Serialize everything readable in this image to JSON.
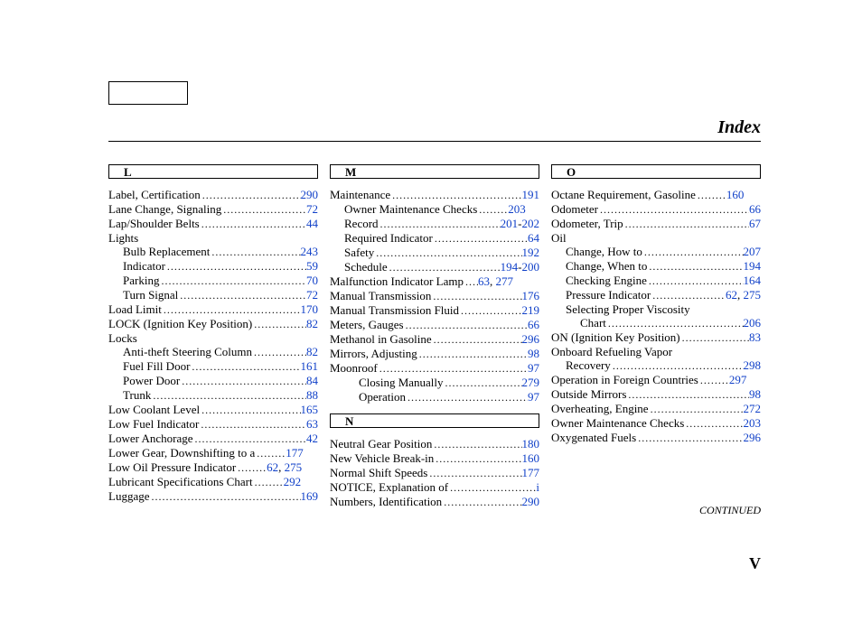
{
  "title": "Index",
  "continued": "CONTINUED",
  "pageNumber": "V",
  "columns": [
    {
      "sections": [
        {
          "letter": "L",
          "entries": [
            {
              "text": "Label, Certification",
              "page": "290",
              "indent": 0
            },
            {
              "text": "Lane Change, Signaling",
              "page": "72",
              "indent": 0
            },
            {
              "text": "Lap/Shoulder Belts",
              "page": "44",
              "indent": 0
            },
            {
              "text": "Lights",
              "page": "",
              "indent": 0,
              "nopage": true
            },
            {
              "text": "Bulb Replacement",
              "page": "243",
              "indent": 1
            },
            {
              "text": "Indicator",
              "page": "59",
              "indent": 1
            },
            {
              "text": "Parking",
              "page": "70",
              "indent": 1
            },
            {
              "text": "Turn Signal",
              "page": "72",
              "indent": 1
            },
            {
              "text": "Load Limit",
              "page": "170",
              "indent": 0
            },
            {
              "text": "LOCK (Ignition Key Position)",
              "page": "82",
              "indent": 0
            },
            {
              "text": "Locks",
              "page": "",
              "indent": 0,
              "nopage": true
            },
            {
              "text": "Anti-theft Steering Column",
              "page": "82",
              "indent": 1
            },
            {
              "text": "Fuel Fill Door",
              "page": "161",
              "indent": 1
            },
            {
              "text": "Power Door",
              "page": "84",
              "indent": 1
            },
            {
              "text": "Trunk",
              "page": "88",
              "indent": 1
            },
            {
              "text": "Low Coolant Level",
              "page": "165",
              "indent": 0
            },
            {
              "text": "Low Fuel Indicator",
              "page": "63",
              "indent": 0
            },
            {
              "text": "Lower Anchorage",
              "page": "42",
              "indent": 0
            },
            {
              "text": "Lower Gear, Downshifting to a",
              "page": "177",
              "indent": 0,
              "tightLeader": true
            },
            {
              "text": "Low Oil Pressure Indicator",
              "page": "62, 275",
              "indent": 0,
              "tightLeader": true,
              "multi": [
                "62",
                "275"
              ]
            },
            {
              "text": "Lubricant Specifications Chart",
              "page": "292",
              "indent": 0,
              "tightLeader": true
            },
            {
              "text": "Luggage",
              "page": "169",
              "indent": 0
            }
          ]
        }
      ]
    },
    {
      "sections": [
        {
          "letter": "M",
          "entries": [
            {
              "text": "Maintenance",
              "page": "191",
              "indent": 0
            },
            {
              "text": "Owner Maintenance Checks",
              "page": "203",
              "indent": 1,
              "tightLeader": true
            },
            {
              "text": "Record",
              "page": "201-202",
              "indent": 1,
              "range": [
                "201",
                "202"
              ]
            },
            {
              "text": "Required Indicator",
              "page": "64",
              "indent": 1
            },
            {
              "text": "Safety",
              "page": "192",
              "indent": 1
            },
            {
              "text": "Schedule",
              "page": "194-200",
              "indent": 1,
              "range": [
                "194",
                "200"
              ]
            },
            {
              "text": "Malfunction Indicator Lamp",
              "page": "63, 277",
              "indent": 0,
              "tightDots": true,
              "multi": [
                "63",
                "277"
              ]
            },
            {
              "text": "Manual Transmission",
              "page": "176",
              "indent": 0
            },
            {
              "text": "Manual Transmission Fluid",
              "page": "219",
              "indent": 0
            },
            {
              "text": "Meters, Gauges",
              "page": "66",
              "indent": 0
            },
            {
              "text": "Methanol in Gasoline",
              "page": "296",
              "indent": 0
            },
            {
              "text": "Mirrors, Adjusting",
              "page": "98",
              "indent": 0
            },
            {
              "text": "Moonroof",
              "page": "97",
              "indent": 0
            },
            {
              "text": "Closing Manually",
              "page": "279",
              "indent": 2
            },
            {
              "text": "Operation",
              "page": "97",
              "indent": 2
            }
          ]
        },
        {
          "letter": "N",
          "entries": [
            {
              "text": "Neutral Gear Position",
              "page": "180",
              "indent": 0
            },
            {
              "text": "New Vehicle Break-in",
              "page": "160",
              "indent": 0
            },
            {
              "text": "Normal Shift Speeds",
              "page": "177",
              "indent": 0
            },
            {
              "text": "NOTICE, Explanation of",
              "page": "i",
              "indent": 0
            },
            {
              "text": "Numbers, Identification",
              "page": "290",
              "indent": 0
            }
          ]
        }
      ]
    },
    {
      "sections": [
        {
          "letter": "O",
          "entries": [
            {
              "text": "Octane Requirement, Gasoline",
              "page": "160",
              "indent": 0,
              "tightLeader": true
            },
            {
              "text": "Odometer",
              "page": "66",
              "indent": 0
            },
            {
              "text": "Odometer, Trip",
              "page": "67",
              "indent": 0
            },
            {
              "text": "Oil",
              "page": "",
              "indent": 0,
              "nopage": true
            },
            {
              "text": "Change, How to",
              "page": "207",
              "indent": 1
            },
            {
              "text": "Change, When to",
              "page": "194",
              "indent": 1
            },
            {
              "text": "Checking Engine",
              "page": "164",
              "indent": 1
            },
            {
              "text": "Pressure Indicator",
              "page": "62, 275",
              "indent": 1,
              "multi": [
                "62",
                "275"
              ]
            },
            {
              "text": "Selecting Proper Viscosity",
              "page": "",
              "indent": 1,
              "nopage": true
            },
            {
              "text": "Chart",
              "page": "206",
              "indent": 1,
              "continuation": true
            },
            {
              "text": "ON (Ignition Key Position)",
              "page": "83",
              "indent": 0
            },
            {
              "text": "Onboard Refueling Vapor",
              "page": "",
              "indent": 0,
              "nopage": true
            },
            {
              "text": "Recovery",
              "page": "298",
              "indent": 1
            },
            {
              "text": "Operation in Foreign Countries",
              "page": "297",
              "indent": 0,
              "tightLeader": true
            },
            {
              "text": "Outside Mirrors",
              "page": "98",
              "indent": 0
            },
            {
              "text": "Overheating, Engine",
              "page": "272",
              "indent": 0
            },
            {
              "text": "Owner Maintenance Checks",
              "page": "203",
              "indent": 0
            },
            {
              "text": "Oxygenated Fuels",
              "page": "296",
              "indent": 0
            }
          ]
        }
      ]
    }
  ]
}
